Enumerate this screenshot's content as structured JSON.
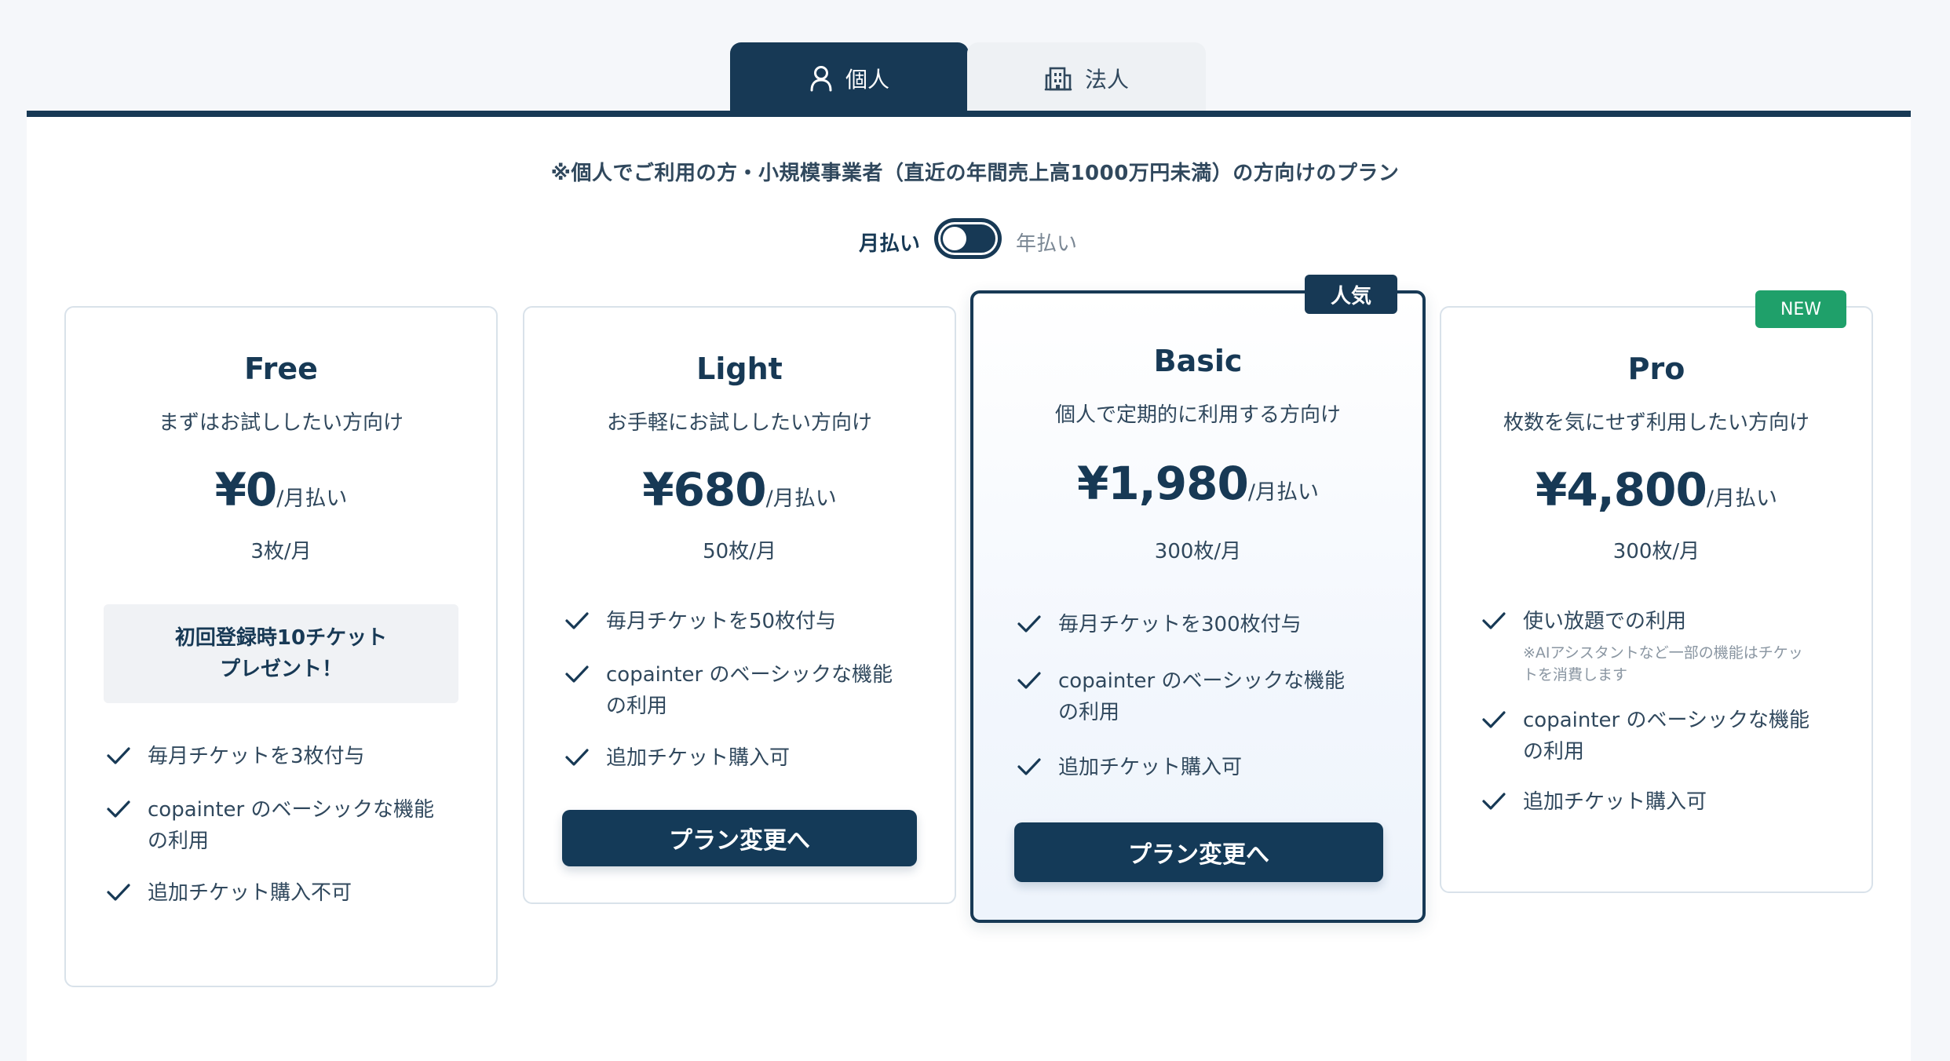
{
  "tabs": {
    "individual": "個人",
    "corporate": "法人"
  },
  "notice": "※個人でご利用の方・小規模事業者（直近の年間売上高1000万円未満）の方向けのプラン",
  "billing": {
    "monthly": "月払い",
    "yearly": "年払い",
    "selected": "月払い"
  },
  "plans": [
    {
      "name": "Free",
      "description": "まずはお試ししたい方向け",
      "price": "¥0",
      "period": "/月払い",
      "quota": "3枚/月",
      "gift_line1": "初回登録時10チケット",
      "gift_line2": "プレゼント！",
      "features": [
        {
          "text": "毎月チケットを3枚付与"
        },
        {
          "text_line1": "copainter のベーシックな機能",
          "text_line2": "の利用"
        },
        {
          "text": "追加チケット購入不可"
        }
      ]
    },
    {
      "name": "Light",
      "description": "お手軽にお試ししたい方向け",
      "price": "¥680",
      "period": "/月払い",
      "quota": "50枚/月",
      "features": [
        {
          "text": "毎月チケットを50枚付与"
        },
        {
          "text_line1": "copainter のベーシックな機能",
          "text_line2": "の利用"
        },
        {
          "text": "追加チケット購入可"
        }
      ],
      "cta": "プラン変更へ"
    },
    {
      "name": "Basic",
      "badge": "人気",
      "description": "個人で定期的に利用する方向け",
      "price": "¥1,980",
      "period": "/月払い",
      "quota": "300枚/月",
      "features": [
        {
          "text": "毎月チケットを300枚付与"
        },
        {
          "text_line1": "copainter のベーシックな機能",
          "text_line2": "の利用"
        },
        {
          "text": "追加チケット購入可"
        }
      ],
      "cta": "プラン変更へ"
    },
    {
      "name": "Pro",
      "badge": "NEW",
      "description": "枚数を気にせず利用したい方向け",
      "price": "¥4,800",
      "period": "/月払い",
      "quota": "300枚/月",
      "features": [
        {
          "text": "使い放題での利用",
          "note_line1": "※AIアシスタントなど一部の機能はチケッ",
          "note_line2": "トを消費します"
        },
        {
          "text_line1": "copainter のベーシックな機能",
          "text_line2": "の利用"
        },
        {
          "text": "追加チケット購入可"
        }
      ]
    }
  ],
  "colors": {
    "primary": "#173955",
    "new_badge": "#1fa06a",
    "card_border": "#d9e2ea",
    "background": "#f5f7fa"
  }
}
